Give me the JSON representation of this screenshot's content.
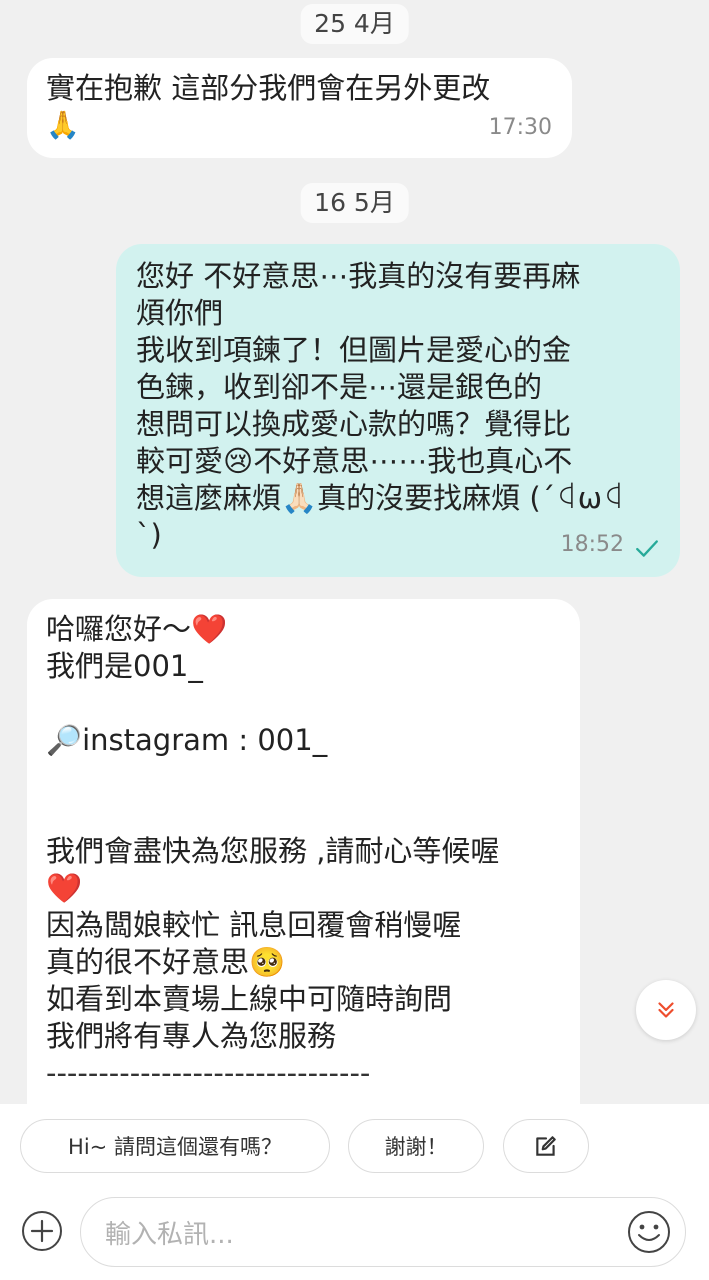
{
  "dates": [
    "25 4月",
    "16 5月"
  ],
  "messages": [
    {
      "direction": "received",
      "lines": [
        "實在抱歉 這部分我們會在另外更改",
        "🙏"
      ],
      "time": "17:30"
    },
    {
      "direction": "sent",
      "lines": [
        "您好 不好意思⋯我真的沒有要再麻",
        "煩你們",
        "我收到項鍊了！但圖片是愛心的金",
        "色鍊，收到卻不是⋯還是銀色的",
        "想問可以換成愛心款的嗎？覺得比",
        "較可愛😢不好意思⋯⋯我也真心不",
        "想這麼麻煩🙏🏻真的沒要找麻煩 (´ꒉωꒉ",
        "`)"
      ],
      "time": "18:52",
      "status_icon": "read-check-icon"
    },
    {
      "direction": "received",
      "lines": [
        "哈囉您好～❤️",
        "我們是001_",
        "",
        "🔎instagram : 001_",
        "",
        "",
        "我們會盡快為您服務 ,請耐心等候喔",
        "❤️",
        "因為闆娘較忙 訊息回覆會稍慢喔",
        "真的很不好意思🥺",
        "如看到本賣場上線中可隨時詢問",
        "我們將有專人為您服務",
        "  -------------------------------"
      ]
    }
  ],
  "quick_replies": [
    "Hi~ 請問這個還有嗎？",
    "謝謝！"
  ],
  "quick_reply_edit_icon": "edit-icon",
  "input": {
    "placeholder": "輸入私訊...",
    "add_icon": "plus-circle-icon",
    "emoji_icon": "smiley-icon"
  },
  "scroll_icon": "double-chevron-down-icon",
  "colors": {
    "background": "#f0f0f0",
    "sent_bubble": "#d2f2ef",
    "received_bubble": "#ffffff",
    "accent": "#ee4d2d",
    "check": "#26aa99"
  }
}
